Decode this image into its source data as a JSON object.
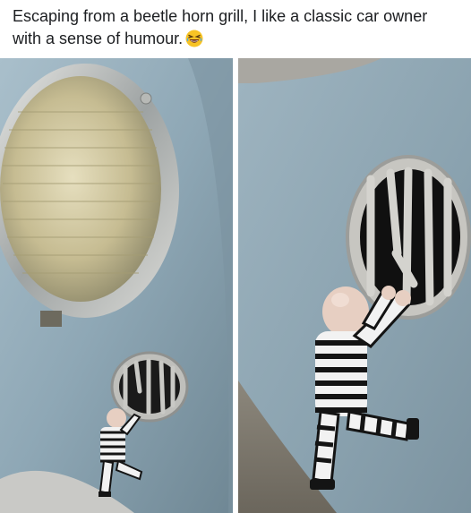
{
  "post": {
    "caption": "Escaping from a beetle horn grill, I like a classic car owner with a sense of humour.",
    "emoji": "laughing-with-tears-emoji"
  },
  "photos": [
    {
      "name": "left-photo-headlight-and-horn-grill"
    },
    {
      "name": "right-photo-closeup-prisoner-figure"
    }
  ],
  "colors": {
    "car_paint": "#8fa8b6",
    "chrome": "#c9c9c4",
    "headlight_glass": "#c8bf98",
    "stripe_dark": "#141414",
    "stripe_light": "#f2f2f2",
    "figure_skin": "#e7cfc2"
  }
}
